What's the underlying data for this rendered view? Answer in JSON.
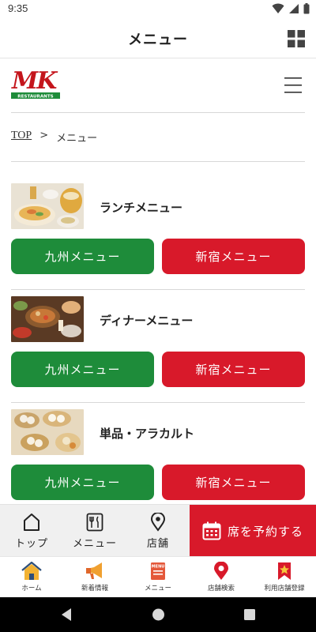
{
  "status_bar": {
    "time": "9:35"
  },
  "app_bar": {
    "title": "メニュー"
  },
  "site": {
    "logo_text": "MK",
    "logo_sub": "RESTAURANTS"
  },
  "breadcrumb": {
    "home": "TOP",
    "separator": ">",
    "current": "メニュー"
  },
  "sections": [
    {
      "name": "ランチメニュー",
      "left_button": "九州メニュー",
      "right_button": "新宿メニュー"
    },
    {
      "name": "ディナーメニュー",
      "left_button": "九州メニュー",
      "right_button": "新宿メニュー"
    },
    {
      "name": "単品・アラカルト",
      "left_button": "九州メニュー",
      "right_button": "新宿メニュー"
    }
  ],
  "action_bar": {
    "top_label": "トップ",
    "menu_label": "メニュー",
    "store_label": "店舗",
    "reserve_label": "席を予約する"
  },
  "tab_bar": {
    "tabs": [
      {
        "label": "ホーム",
        "icon": "home-icon"
      },
      {
        "label": "新着情報",
        "icon": "megaphone-icon"
      },
      {
        "label": "メニュー",
        "icon": "menu-book-icon"
      },
      {
        "label": "店舗検索",
        "icon": "map-pin-icon"
      },
      {
        "label": "利用店舗登録",
        "icon": "star-bookmark-icon"
      }
    ]
  },
  "colors": {
    "green": "#1e8c3a",
    "red": "#d8192a",
    "brand_red": "#c4151c"
  }
}
